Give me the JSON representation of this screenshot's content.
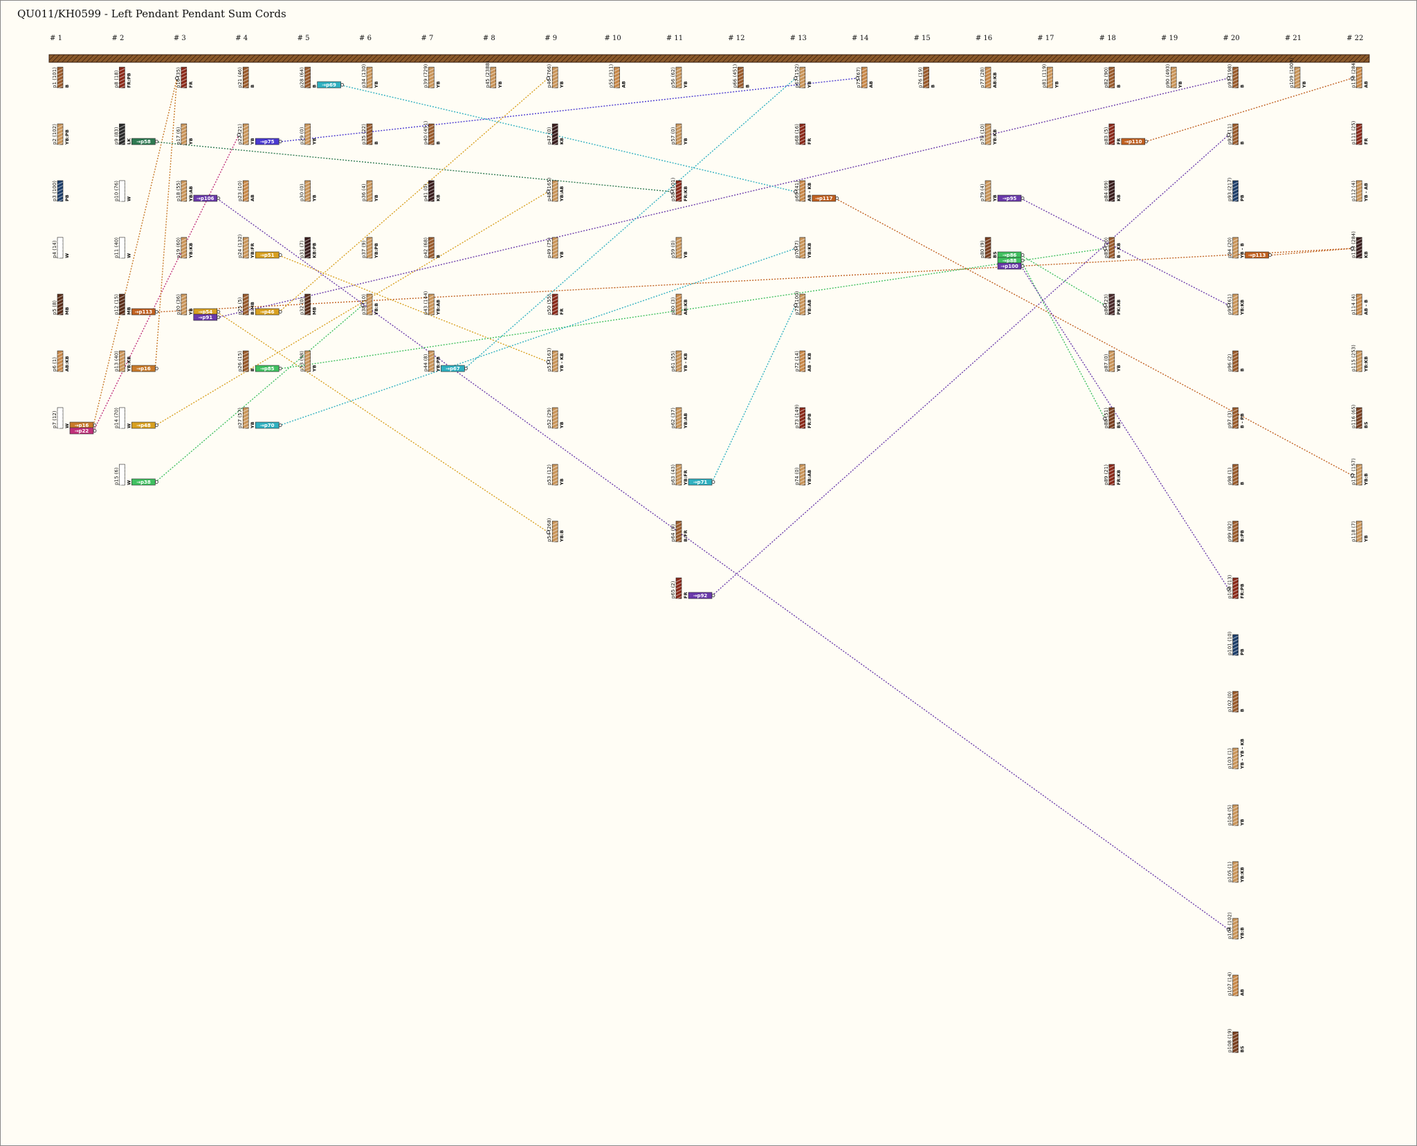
{
  "title": "QU011/KH0599 - Left Pendant Pendant Sum Cords",
  "colors": {
    "background": "#fffdf5",
    "primary_cord": "#8b5a2b",
    "AB": "#c8894a",
    "B": "#9a5b2c",
    "YB": "#c9955a",
    "W": "#ffffff",
    "KB": "#3a1e1e",
    "FR": "#8b2a1a",
    "PB": "#1e3f6b",
    "MB": "#5b2f1a",
    "BS": "#7a4020",
    "LK": "#2a2a2a",
    "PK": "#4a2a2a"
  },
  "groups": [
    "# 1",
    "# 2",
    "# 3",
    "# 4",
    "# 5",
    "# 6",
    "# 7",
    "# 8",
    "# 9",
    "# 10",
    "# 11",
    "# 12",
    "# 13",
    "# 14",
    "# 15",
    "# 16",
    "# 17",
    "# 18",
    "# 19",
    "# 20",
    "# 21",
    "# 22"
  ],
  "pendants": [
    {
      "id": "p1",
      "text": "p1 (101)",
      "color": "B",
      "g": 0,
      "r": 0
    },
    {
      "id": "p2",
      "text": "p2 (102)",
      "color": "YB:PB",
      "g": 0,
      "r": 1
    },
    {
      "id": "p3",
      "text": "p3 (100)",
      "color": "PB",
      "g": 0,
      "r": 2
    },
    {
      "id": "p4",
      "text": "p4 (14)",
      "color": "W",
      "g": 0,
      "r": 3
    },
    {
      "id": "p5",
      "text": "p5 (8)",
      "color": "MB",
      "g": 0,
      "r": 4
    },
    {
      "id": "p6",
      "text": "p6 (1)",
      "color": "AB:KB",
      "g": 0,
      "r": 5
    },
    {
      "id": "p7",
      "text": "p7 (12)",
      "color": "W",
      "g": 0,
      "r": 6
    },
    {
      "id": "p8",
      "text": "p8 (18)",
      "color": "FR:PB",
      "g": 1,
      "r": 0
    },
    {
      "id": "p9",
      "text": "p9 (83)",
      "color": "LK",
      "g": 1,
      "r": 1
    },
    {
      "id": "p10",
      "text": "p10 (76)",
      "color": "W",
      "g": 1,
      "r": 2
    },
    {
      "id": "p11",
      "text": "p11 (40)",
      "color": "W",
      "g": 1,
      "r": 3
    },
    {
      "id": "p12",
      "text": "p12 (15)",
      "color": "MB",
      "g": 1,
      "r": 4
    },
    {
      "id": "p13",
      "text": "p13 (40)",
      "color": "YB:KB",
      "g": 1,
      "r": 5
    },
    {
      "id": "p14",
      "text": "p14 (70)",
      "color": "W",
      "g": 1,
      "r": 6
    },
    {
      "id": "p15",
      "text": "p15 (6)",
      "color": "W",
      "g": 1,
      "r": 7
    },
    {
      "id": "p16",
      "text": "p16 (35)",
      "color": "FR",
      "g": 2,
      "r": 0
    },
    {
      "id": "p17",
      "text": "p17 (6)",
      "color": "YB",
      "g": 2,
      "r": 1
    },
    {
      "id": "p18",
      "text": "p18 (55)",
      "color": "YB:AB",
      "g": 2,
      "r": 2
    },
    {
      "id": "p19",
      "text": "p19 (60)",
      "color": "YB:KB",
      "g": 2,
      "r": 3
    },
    {
      "id": "p20",
      "text": "p20 (36)",
      "color": "YB",
      "g": 2,
      "r": 4
    },
    {
      "id": "p21",
      "text": "p21 (46)",
      "color": "B",
      "g": 3,
      "r": 0
    },
    {
      "id": "p22",
      "text": "p22 (21)",
      "color": "YB",
      "g": 3,
      "r": 1
    },
    {
      "id": "p23",
      "text": "p23 (10)",
      "color": "AB",
      "g": 3,
      "r": 2
    },
    {
      "id": "p24",
      "text": "p24 (132)",
      "color": "YB:FR",
      "g": 3,
      "r": 3
    },
    {
      "id": "p25",
      "text": "p25 (5)",
      "color": "B:MB",
      "g": 3,
      "r": 4
    },
    {
      "id": "p26",
      "text": "p26 (15)",
      "color": "B",
      "g": 3,
      "r": 5
    },
    {
      "id": "p27",
      "text": "p27 (57)",
      "color": "YB",
      "g": 3,
      "r": 6
    },
    {
      "id": "p28",
      "text": "p28 (64)",
      "color": "B",
      "g": 4,
      "r": 0
    },
    {
      "id": "p29",
      "text": "p29 (0)",
      "color": "YB",
      "g": 4,
      "r": 1
    },
    {
      "id": "p30",
      "text": "p30 (0)",
      "color": "YB",
      "g": 4,
      "r": 2
    },
    {
      "id": "p31",
      "text": "p31 (7)",
      "color": "KB:PB",
      "g": 4,
      "r": 3
    },
    {
      "id": "p32",
      "text": "p32 (0)",
      "color": "MB",
      "g": 4,
      "r": 4
    },
    {
      "id": "p33",
      "text": "p33 (98)",
      "color": "YB",
      "g": 4,
      "r": 5
    },
    {
      "id": "p34",
      "text": "p34 (130)",
      "color": "YB",
      "g": 5,
      "r": 0
    },
    {
      "id": "p35",
      "text": "p35 (22)",
      "color": "B",
      "g": 5,
      "r": 1
    },
    {
      "id": "p36",
      "text": "p36 (4)",
      "color": "YB",
      "g": 5,
      "r": 2
    },
    {
      "id": "p37",
      "text": "p37 (9)",
      "color": "YB:PB",
      "g": 5,
      "r": 3
    },
    {
      "id": "p38",
      "text": "p38 (10)",
      "color": "YB:B",
      "g": 5,
      "r": 4
    },
    {
      "id": "p39",
      "text": "p39 (729)",
      "color": "YB",
      "g": 6,
      "r": 0
    },
    {
      "id": "p40",
      "text": "p40 (451)",
      "color": "B",
      "g": 6,
      "r": 1
    },
    {
      "id": "p41",
      "text": "p41 (0)",
      "color": "KB",
      "g": 6,
      "r": 2
    },
    {
      "id": "p42",
      "text": "p42 (68)",
      "color": "B",
      "g": 6,
      "r": 3
    },
    {
      "id": "p43",
      "text": "p43 (144)",
      "color": "YB:AB",
      "g": 6,
      "r": 4
    },
    {
      "id": "p44",
      "text": "p44 (8)",
      "color": "YB:PB",
      "g": 6,
      "r": 5
    },
    {
      "id": "p45",
      "text": "p45 (2388)",
      "color": "YB",
      "g": 7,
      "r": 0
    },
    {
      "id": "p46",
      "text": "p46 (766)",
      "color": "YB",
      "g": 8,
      "r": 0
    },
    {
      "id": "p47",
      "text": "p47 (0)",
      "color": "KB",
      "g": 8,
      "r": 1
    },
    {
      "id": "p48",
      "text": "p48 (165)",
      "color": "YB:AB",
      "g": 8,
      "r": 2
    },
    {
      "id": "p49",
      "text": "p49 (75)",
      "color": "YB",
      "g": 8,
      "r": 3
    },
    {
      "id": "p50",
      "text": "p50 (55)",
      "color": "FR",
      "g": 8,
      "r": 4
    },
    {
      "id": "p51",
      "text": "p51 (163)",
      "color": "YB - KB",
      "g": 8,
      "r": 5
    },
    {
      "id": "p52",
      "text": "p52 (29)",
      "color": "YB",
      "g": 8,
      "r": 6
    },
    {
      "id": "p53",
      "text": "p53 (12)",
      "color": "YB",
      "g": 8,
      "r": 7
    },
    {
      "id": "p54",
      "text": "p54 (268)",
      "color": "YB:B",
      "g": 8,
      "r": 8
    },
    {
      "id": "p55",
      "text": "p55 (311)",
      "color": "AB",
      "g": 9,
      "r": 0
    },
    {
      "id": "p56",
      "text": "p56 (62)",
      "color": "YB",
      "g": 10,
      "r": 0
    },
    {
      "id": "p57",
      "text": "p57 (0)",
      "color": "YB",
      "g": 10,
      "r": 1
    },
    {
      "id": "p58",
      "text": "p58 (101)",
      "color": "FR:KB",
      "g": 10,
      "r": 2
    },
    {
      "id": "p59",
      "text": "p59 (0)",
      "color": "YB",
      "g": 10,
      "r": 3
    },
    {
      "id": "p60",
      "text": "p60 (3)",
      "color": "AB:KB",
      "g": 10,
      "r": 4
    },
    {
      "id": "p61",
      "text": "p61 (55)",
      "color": "YB - KB",
      "g": 10,
      "r": 5
    },
    {
      "id": "p62",
      "text": "p62 (37)",
      "color": "YB:AB",
      "g": 10,
      "r": 6
    },
    {
      "id": "p63",
      "text": "p63 (43)",
      "color": "YB:FR",
      "g": 10,
      "r": 7
    },
    {
      "id": "p64",
      "text": "p64 (9)",
      "color": "B:FR",
      "g": 10,
      "r": 8
    },
    {
      "id": "p65",
      "text": "p65 (2)",
      "color": "FR",
      "g": 10,
      "r": 9
    },
    {
      "id": "p66",
      "text": "p66 (451)",
      "color": "B",
      "g": 11,
      "r": 0
    },
    {
      "id": "p67",
      "text": "p67 (152)",
      "color": "YB",
      "g": 12,
      "r": 0
    },
    {
      "id": "p68",
      "text": "p68 (16)",
      "color": "FR",
      "g": 12,
      "r": 1
    },
    {
      "id": "p69",
      "text": "p69 (41)",
      "color": "AB - KB",
      "g": 12,
      "r": 2
    },
    {
      "id": "p70",
      "text": "p70 (7)",
      "color": "YB:KB",
      "g": 12,
      "r": 3
    },
    {
      "id": "p71",
      "text": "p71 (100)",
      "color": "YB:AB",
      "g": 12,
      "r": 4
    },
    {
      "id": "p72",
      "text": "p72 (14)",
      "color": "AB - KB",
      "g": 12,
      "r": 5
    },
    {
      "id": "p73",
      "text": "p73 (149)",
      "color": "FR:PB",
      "g": 12,
      "r": 6
    },
    {
      "id": "p74",
      "text": "p74 (0)",
      "color": "YB:AB",
      "g": 12,
      "r": 7
    },
    {
      "id": "p75",
      "text": "p75 (67)",
      "color": "AB",
      "g": 13,
      "r": 0
    },
    {
      "id": "p76",
      "text": "p76 (19)",
      "color": "B",
      "g": 14,
      "r": 0
    },
    {
      "id": "p77",
      "text": "p77 (28)",
      "color": "AB:KB",
      "g": 15,
      "r": 0
    },
    {
      "id": "p78",
      "text": "p78 (10)",
      "color": "YB:KB",
      "g": 15,
      "r": 1
    },
    {
      "id": "p79",
      "text": "p79 (4)",
      "color": "YB",
      "g": 15,
      "r": 2
    },
    {
      "id": "p80",
      "text": "p80 (9)",
      "color": "BS",
      "g": 15,
      "r": 3
    },
    {
      "id": "p81",
      "text": "p81 (119)",
      "color": "YB",
      "g": 16,
      "r": 0
    },
    {
      "id": "p82",
      "text": "p82 (90)",
      "color": "B",
      "g": 17,
      "r": 0
    },
    {
      "id": "p83",
      "text": "p83 (5)",
      "color": "FR",
      "g": 17,
      "r": 1
    },
    {
      "id": "p84",
      "text": "p84 (69)",
      "color": "KB",
      "g": 17,
      "r": 2
    },
    {
      "id": "p85",
      "text": "p85 (20)",
      "color": "B - KB",
      "g": 17,
      "r": 3
    },
    {
      "id": "p86",
      "text": "p86 (23)",
      "color": "PK:KB",
      "g": 17,
      "r": 4
    },
    {
      "id": "p87",
      "text": "p87 (0)",
      "color": "YB",
      "g": 17,
      "r": 5
    },
    {
      "id": "p88",
      "text": "p88 (51)",
      "color": "BS",
      "g": 17,
      "r": 6
    },
    {
      "id": "p89",
      "text": "p89 (21)",
      "color": "FR:KB",
      "g": 17,
      "r": 7
    },
    {
      "id": "p90",
      "text": "p90 (493)",
      "color": "YB",
      "g": 18,
      "r": 0
    },
    {
      "id": "p91",
      "text": "p91 (198)",
      "color": "B",
      "g": 19,
      "r": 0
    },
    {
      "id": "p92",
      "text": "p92 (11)",
      "color": "B",
      "g": 19,
      "r": 1
    },
    {
      "id": "p93",
      "text": "p93 (217)",
      "color": "PB",
      "g": 19,
      "r": 2
    },
    {
      "id": "p94",
      "text": "p94 (20)",
      "color": "YB - B",
      "g": 19,
      "r": 3
    },
    {
      "id": "p95",
      "text": "p95 (61)",
      "color": "YB:KB",
      "g": 19,
      "r": 4
    },
    {
      "id": "p96",
      "text": "p96 (2)",
      "color": "B",
      "g": 19,
      "r": 5
    },
    {
      "id": "p97",
      "text": "p97 (3)",
      "color": "B - PB",
      "g": 19,
      "r": 6
    },
    {
      "id": "p98",
      "text": "p98 (1)",
      "color": "B",
      "g": 19,
      "r": 7
    },
    {
      "id": "p99",
      "text": "p99 (92)",
      "color": "B:PB",
      "g": 19,
      "r": 8
    },
    {
      "id": "p100",
      "text": "p100 (13)",
      "color": "FR:PB",
      "g": 19,
      "r": 9
    },
    {
      "id": "p101",
      "text": "p101 (10)",
      "color": "PB",
      "g": 19,
      "r": 10
    },
    {
      "id": "p102",
      "text": "p102 (0)",
      "color": "B",
      "g": 19,
      "r": 11
    },
    {
      "id": "p103",
      "text": "p103 (1)",
      "color": "YB - YB - KB",
      "g": 19,
      "r": 12
    },
    {
      "id": "p104",
      "text": "p104 (5)",
      "color": "YB",
      "g": 19,
      "r": 13
    },
    {
      "id": "p105",
      "text": "p105 (1)",
      "color": "YB:KB",
      "g": 19,
      "r": 14
    },
    {
      "id": "p106",
      "text": "p106 (102)",
      "color": "YB:B",
      "g": 19,
      "r": 15
    },
    {
      "id": "p107",
      "text": "p107 (14)",
      "color": "AB",
      "g": 19,
      "r": 16
    },
    {
      "id": "p108",
      "text": "p108 (19)",
      "color": "BS",
      "g": 19,
      "r": 17
    },
    {
      "id": "p109",
      "text": "p109 (1009)",
      "color": "YB",
      "g": 20,
      "r": 0
    },
    {
      "id": "p110",
      "text": "p110 (284)",
      "color": "AB",
      "g": 21,
      "r": 0
    },
    {
      "id": "p111",
      "text": "p111 (25)",
      "color": "FR",
      "g": 21,
      "r": 1
    },
    {
      "id": "p112",
      "text": "p112 (4)",
      "color": "YB - AB",
      "g": 21,
      "r": 2
    },
    {
      "id": "p113",
      "text": "p113 (284)",
      "color": "KB",
      "g": 21,
      "r": 3
    },
    {
      "id": "p114",
      "text": "p114 (4)",
      "color": "AB - B",
      "g": 21,
      "r": 4
    },
    {
      "id": "p115",
      "text": "p115 (253)",
      "color": "YB:KB",
      "g": 21,
      "r": 5
    },
    {
      "id": "p116",
      "text": "p116 (65)",
      "color": "BS",
      "g": 21,
      "r": 6
    },
    {
      "id": "p117",
      "text": "p117 (157)",
      "color": "YB:B",
      "g": 21,
      "r": 7
    },
    {
      "id": "p118",
      "text": "p118 (7)",
      "color": "YB",
      "g": 21,
      "r": 8
    }
  ],
  "tags": [
    {
      "text": "→p16",
      "from": "p7",
      "to": "p16",
      "color": "#c87a2a"
    },
    {
      "text": "→p22",
      "from": "p7",
      "to": "p22",
      "color": "#c0307a"
    },
    {
      "text": "→p58",
      "from": "p9",
      "to": "p58",
      "color": "#2e7a52"
    },
    {
      "text": "→p113",
      "from": "p12",
      "to": "p113",
      "color": "#c06020"
    },
    {
      "text": "→p16",
      "from": "p13",
      "to": "p16",
      "color": "#c87a2a"
    },
    {
      "text": "→p48",
      "from": "p14",
      "to": "p48",
      "color": "#d8a020"
    },
    {
      "text": "→p38",
      "from": "p15",
      "to": "p38",
      "color": "#40c060"
    },
    {
      "text": "→p106",
      "from": "p18",
      "to": "p106",
      "color": "#6a3aaa"
    },
    {
      "text": "→p54",
      "from": "p20",
      "to": "p54",
      "color": "#d8a020"
    },
    {
      "text": "→p91",
      "from": "p20",
      "to": "p91",
      "color": "#6a3aaa"
    },
    {
      "text": "→p75",
      "from": "p22",
      "to": "p75",
      "color": "#4a3ad0"
    },
    {
      "text": "→p51",
      "from": "p24",
      "to": "p51",
      "color": "#d8a020"
    },
    {
      "text": "→p46",
      "from": "p25",
      "to": "p46",
      "color": "#d8a020"
    },
    {
      "text": "→p85",
      "from": "p26",
      "to": "p85",
      "color": "#40c060"
    },
    {
      "text": "→p70",
      "from": "p27",
      "to": "p70",
      "color": "#30b0c0"
    },
    {
      "text": "→p69",
      "from": "p28",
      "to": "p69",
      "color": "#30b0c0"
    },
    {
      "text": "→p67",
      "from": "p44",
      "to": "p67",
      "color": "#30b0c0"
    },
    {
      "text": "→p71",
      "from": "p63",
      "to": "p71",
      "color": "#30b0c0"
    },
    {
      "text": "→p92",
      "from": "p65",
      "to": "p92",
      "color": "#6a3aaa"
    },
    {
      "text": "→p117",
      "from": "p69",
      "to": "p117",
      "color": "#c06020"
    },
    {
      "text": "→p95",
      "from": "p79",
      "to": "p95",
      "color": "#6a3aaa"
    },
    {
      "text": "→p86",
      "from": "p80",
      "to": "p86",
      "color": "#40c060"
    },
    {
      "text": "→p88",
      "from": "p80",
      "to": "p88",
      "color": "#40c060"
    },
    {
      "text": "→p100",
      "from": "p80",
      "to": "p100",
      "color": "#6a3aaa"
    },
    {
      "text": "→p110",
      "from": "p83",
      "to": "p110",
      "color": "#c06020"
    },
    {
      "text": "→p113",
      "from": "p94",
      "to": "p113",
      "color": "#c06020"
    }
  ]
}
